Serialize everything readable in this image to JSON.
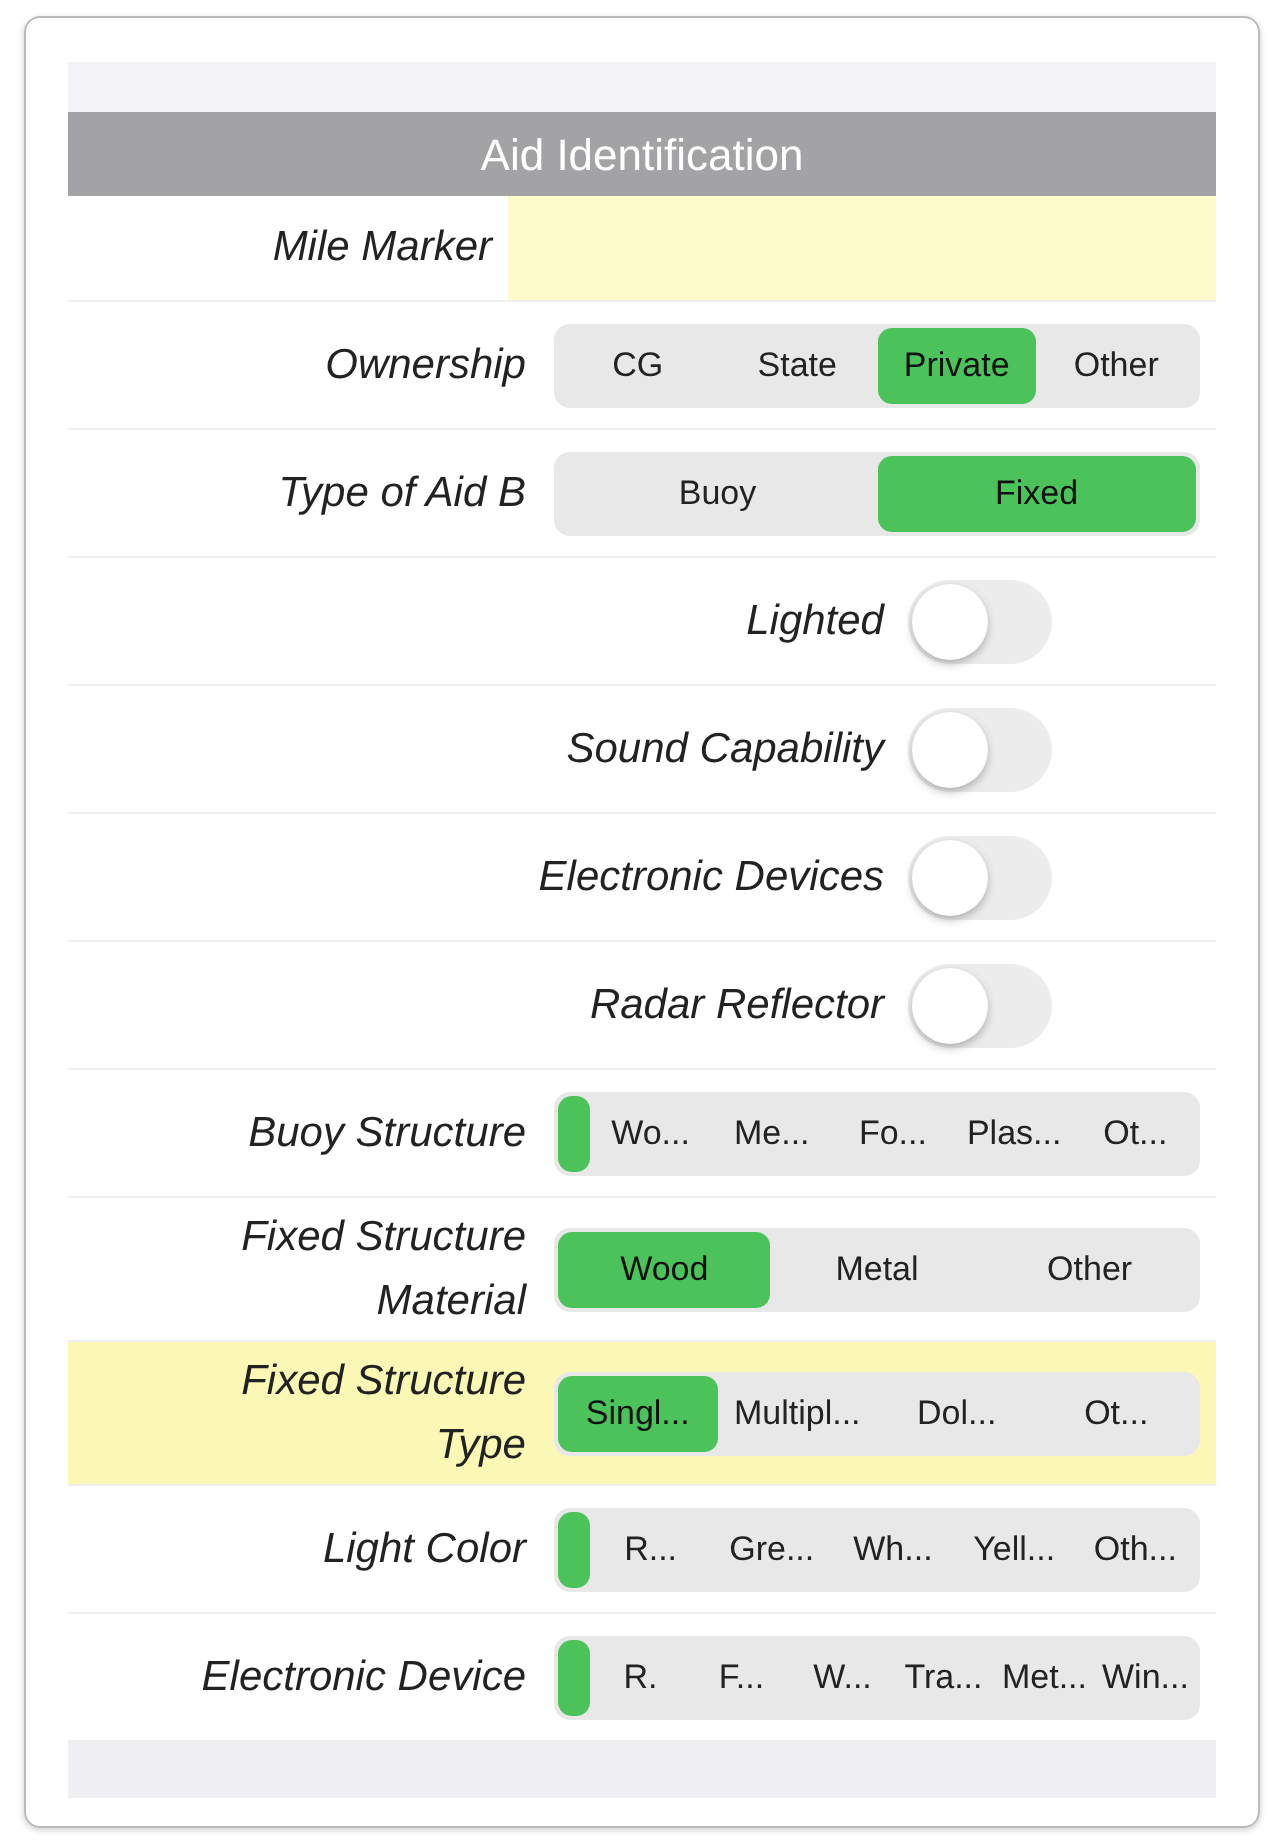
{
  "section": {
    "title": "Aid Identification"
  },
  "rows": [
    {
      "kind": "text",
      "label": "Mile Marker",
      "highlighted": false
    },
    {
      "kind": "segmented",
      "label": "Ownership",
      "highlighted": false,
      "segments": [
        {
          "label": "CG",
          "selected": false
        },
        {
          "label": "State",
          "selected": false
        },
        {
          "label": "Private",
          "selected": true
        },
        {
          "label": "Other",
          "selected": false
        }
      ]
    },
    {
      "kind": "segmented",
      "label": "Type of Aid B",
      "highlighted": false,
      "segments": [
        {
          "label": "Buoy",
          "selected": false
        },
        {
          "label": "Fixed",
          "selected": true
        }
      ]
    },
    {
      "kind": "toggle",
      "label": "Lighted",
      "highlighted": false,
      "on": false
    },
    {
      "kind": "toggle",
      "label": "Sound Capability",
      "highlighted": false,
      "on": false
    },
    {
      "kind": "toggle",
      "label": "Electronic Devices",
      "highlighted": false,
      "on": false
    },
    {
      "kind": "toggle",
      "label": "Radar Reflector",
      "highlighted": false,
      "on": false
    },
    {
      "kind": "segmented",
      "label": "Buoy Structure",
      "highlighted": false,
      "segments": [
        {
          "selected": true
        },
        {
          "label": "Wo...",
          "selected": false
        },
        {
          "label": "Me...",
          "selected": false
        },
        {
          "label": "Fo...",
          "selected": false
        },
        {
          "label": "Plas...",
          "selected": false
        },
        {
          "label": "Ot...",
          "selected": false
        }
      ]
    },
    {
      "kind": "segmented",
      "label": "Fixed Structure Material",
      "highlighted": false,
      "segments": [
        {
          "label": "Wood",
          "selected": true
        },
        {
          "label": "Metal",
          "selected": false
        },
        {
          "label": "Other",
          "selected": false
        }
      ]
    },
    {
      "kind": "segmented",
      "label": "Fixed Structure Type",
      "highlighted": true,
      "segments": [
        {
          "label": "Singl...",
          "selected": true
        },
        {
          "label": "Multipl...",
          "selected": false
        },
        {
          "label": "Dol...",
          "selected": false
        },
        {
          "label": "Ot...",
          "selected": false
        }
      ]
    },
    {
      "kind": "segmented",
      "label": "Light Color",
      "highlighted": false,
      "segments": [
        {
          "selected": true
        },
        {
          "label": "R...",
          "selected": false
        },
        {
          "label": "Gre...",
          "selected": false
        },
        {
          "label": "Wh...",
          "selected": false
        },
        {
          "label": "Yell...",
          "selected": false
        },
        {
          "label": "Oth...",
          "selected": false
        }
      ]
    },
    {
      "kind": "segmented",
      "label": "Electronic Device",
      "highlighted": false,
      "segments": [
        {
          "selected": true
        },
        {
          "label": "R.",
          "selected": false
        },
        {
          "label": "F...",
          "selected": false
        },
        {
          "label": "W...",
          "selected": false
        },
        {
          "label": "Tra...",
          "selected": false
        },
        {
          "label": "Met...",
          "selected": false
        },
        {
          "label": "Win...",
          "selected": false
        }
      ]
    }
  ]
}
